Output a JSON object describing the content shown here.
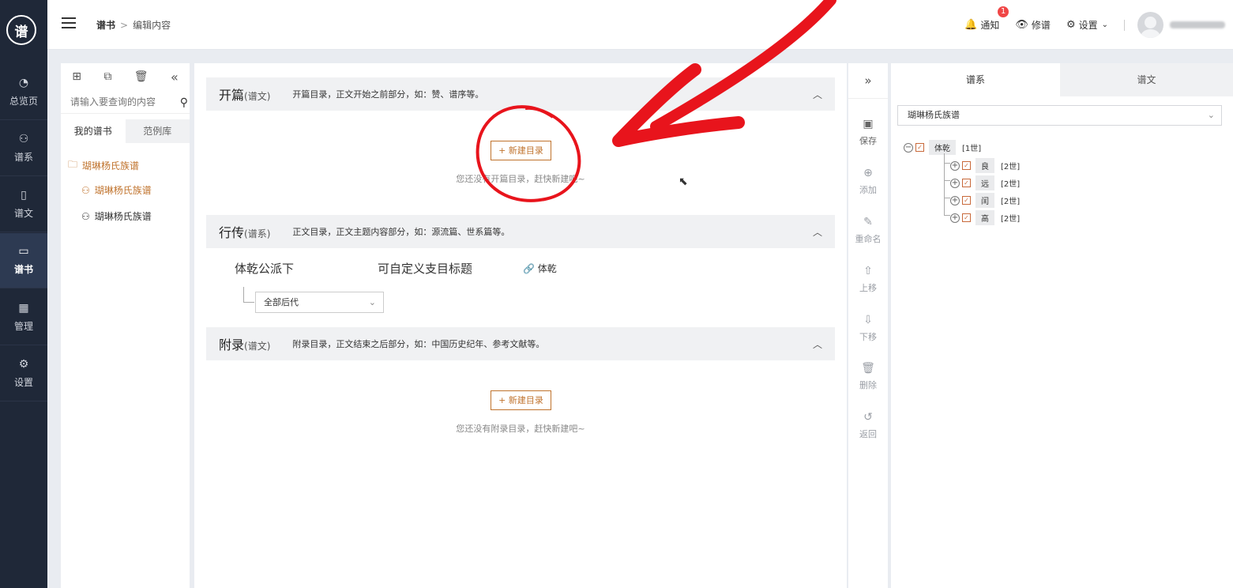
{
  "leftnav": {
    "logo_text": "谱",
    "items": [
      {
        "label": "总览页",
        "icon": "◔"
      },
      {
        "label": "谱系",
        "icon": "⚇"
      },
      {
        "label": "谱文",
        "icon": "▯"
      },
      {
        "label": "谱书",
        "icon": "▭"
      },
      {
        "label": "管理",
        "icon": "▦"
      },
      {
        "label": "设置",
        "icon": "⚙"
      }
    ]
  },
  "header": {
    "breadcrumb": {
      "root": "谱书",
      "sep": ">",
      "current": "编辑内容"
    },
    "notify_label": "通知",
    "notify_count": "1",
    "notify_icon": "bell-icon",
    "view_label": "修谱",
    "view_icon": "eye-icon",
    "settings_label": "设置",
    "settings_icon": "gear-icon"
  },
  "tree_panel": {
    "tools": [
      "+",
      "⧉",
      "🗑",
      "«"
    ],
    "search_placeholder": "请输入要查询的内容",
    "tabs": [
      "我的谱书",
      "范例库"
    ],
    "nodes": [
      "瑚琳杨氏族谱",
      "瑚琳杨氏族谱",
      "瑚琳杨氏族谱"
    ]
  },
  "sections": {
    "opening": {
      "title": "开篇",
      "tag": "(谱文)",
      "desc": "开篇目录，正文开始之前部分，如：赞、谱序等。",
      "new_btn": "+ 新建目录",
      "empty": "您还没有开篇目录，赶快新建吧~"
    },
    "body": {
      "title": "行传",
      "tag": "(谱系)",
      "desc": "正文目录，正文主题内容部分，如：源流篇、世系篇等。",
      "row_title": "体乾公派下",
      "row_custom": "可自定义支目标题",
      "row_link": "体乾",
      "select": "全部后代"
    },
    "appendix": {
      "title": "附录",
      "tag": "(谱文)",
      "desc": "附录目录，正文结束之后部分，如：中国历史纪年、参考文献等。",
      "new_btn": "+ 新建目录",
      "empty": "您还没有附录目录，赶快新建吧~"
    }
  },
  "vtool": {
    "expand": "»",
    "buttons": [
      {
        "label": "保存",
        "icon": "save-icon"
      },
      {
        "label": "添加",
        "icon": "add-icon"
      },
      {
        "label": "重命名",
        "icon": "edit-icon"
      },
      {
        "label": "上移",
        "icon": "up-icon"
      },
      {
        "label": "下移",
        "icon": "down-icon"
      },
      {
        "label": "删除",
        "icon": "trash-icon"
      },
      {
        "label": "返回",
        "icon": "back-icon"
      }
    ]
  },
  "right_panel": {
    "tabs": [
      "谱系",
      "谱文"
    ],
    "select": "瑚琳杨氏族谱",
    "root": {
      "name": "体乾",
      "gen": "[1世]"
    },
    "children": [
      {
        "name": "良",
        "gen": "[2世]"
      },
      {
        "name": "远",
        "gen": "[2世]"
      },
      {
        "name": "闰",
        "gen": "[2世]"
      },
      {
        "name": "高",
        "gen": "[2世]"
      }
    ]
  },
  "colors": {
    "accent": "#c0732d",
    "nav_bg": "#1f2838",
    "annotation": "#e8141c"
  }
}
